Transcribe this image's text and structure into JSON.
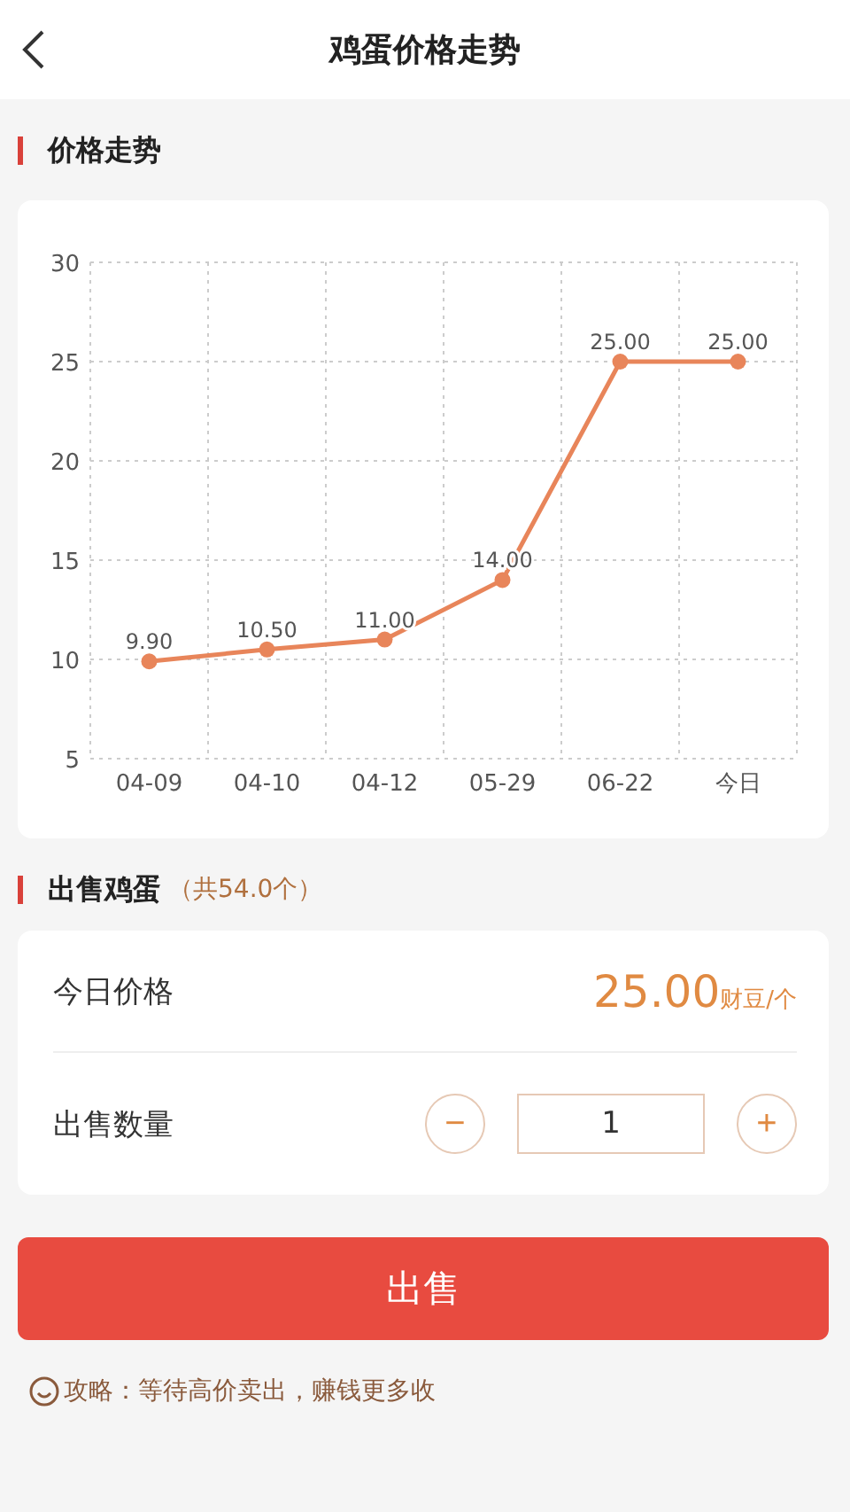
{
  "header": {
    "title": "鸡蛋价格走势"
  },
  "trend": {
    "title": "价格走势",
    "chart_data": {
      "type": "line",
      "categories": [
        "04-09",
        "04-10",
        "04-12",
        "05-29",
        "06-22",
        "今日"
      ],
      "series": [
        {
          "color": "#e8855a",
          "marker": "circle",
          "values": [
            9.9,
            10.5,
            11.0,
            14.0,
            25.0,
            25.0
          ]
        }
      ],
      "ylim": [
        5,
        30
      ],
      "yticks": [
        5,
        10,
        15,
        20,
        25,
        30
      ],
      "grid": true,
      "data_labels": "value_labels",
      "value_labels": [
        "9.90",
        "10.50",
        "11.00",
        "14.00",
        "25.00",
        "25.00"
      ]
    }
  },
  "sell": {
    "title": "出售鸡蛋",
    "count": "（共54.0个）",
    "price_label": "今日价格",
    "price": "25.00",
    "price_unit": "财豆/个",
    "quantity_label": "出售数量",
    "minus": "−",
    "quantity": "1",
    "plus": "+",
    "button": "出售"
  },
  "tip": "攻略：等待高价卖出，赚钱更多收"
}
